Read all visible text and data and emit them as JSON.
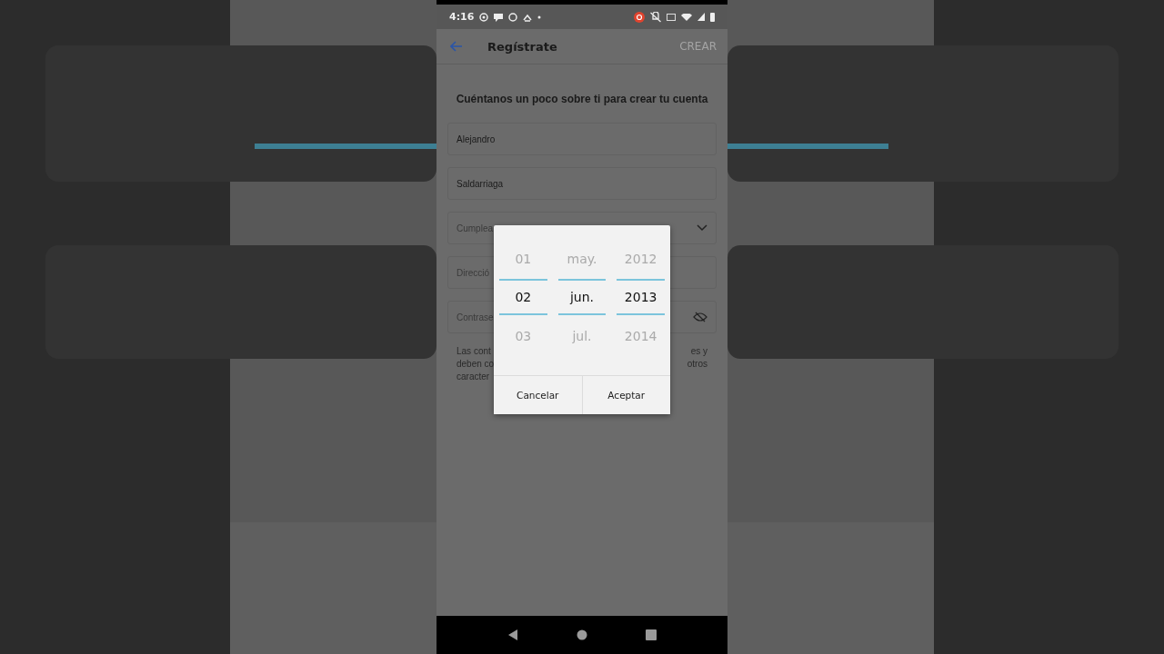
{
  "status_bar": {
    "time": "4:16"
  },
  "app_bar": {
    "title": "Regístrate",
    "action": {
      "label": "CREAR",
      "disabled": true
    }
  },
  "intro": "Cuéntanos un poco sobre ti para crear tu cuenta",
  "fields": [
    {
      "kind": "text",
      "value": "Alejandro"
    },
    {
      "kind": "text",
      "value": "Saldarriaga"
    },
    {
      "kind": "dropdown",
      "placeholder": "Cumplea"
    },
    {
      "kind": "text",
      "placeholder": "Direcció"
    },
    {
      "kind": "password",
      "placeholder": "Contrase"
    }
  ],
  "helper_lines": [
    {
      "left": "Las cont",
      "right": "es y"
    },
    {
      "left": "deben co",
      "right": "otros"
    },
    {
      "left": "caracter"
    }
  ],
  "date_picker": {
    "columns": [
      {
        "items": [
          {
            "label": "01",
            "selected": false
          },
          {
            "label": "02",
            "selected": true
          },
          {
            "label": "03",
            "selected": false
          }
        ]
      },
      {
        "items": [
          {
            "label": "may.",
            "selected": false
          },
          {
            "label": "jun.",
            "selected": true
          },
          {
            "label": "jul.",
            "selected": false
          }
        ]
      },
      {
        "items": [
          {
            "label": "2012",
            "selected": false
          },
          {
            "label": "2013",
            "selected": true
          },
          {
            "label": "2014",
            "selected": false
          }
        ]
      }
    ],
    "buttons": [
      "Cancelar",
      "Aceptar"
    ]
  }
}
